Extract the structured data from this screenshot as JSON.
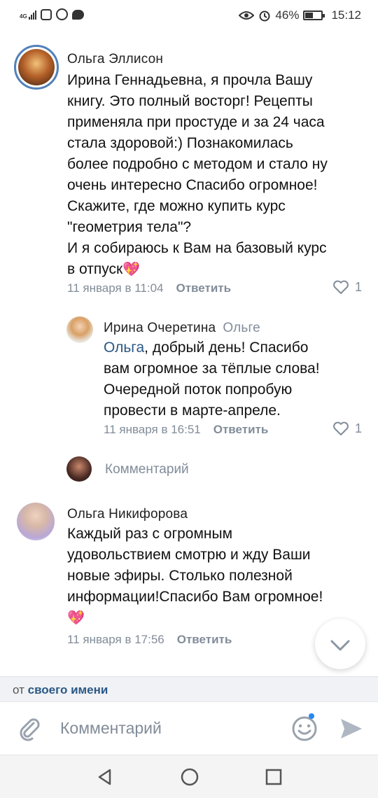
{
  "status_bar": {
    "network": "4G",
    "battery": "46%",
    "time": "15:12"
  },
  "comments": [
    {
      "author": "Ольга Эллисон",
      "text": "Ирина Геннадьевна, я прочла Вашу\nкнигу. Это полный восторг! Рецепты\nприменяла при простуде и за 24 часа\nстала здоровой:) Познакомилась\nболее подробно с методом и стало ну\nочень интересно Спасибо огромное!\nСкажите, где можно купить курс\n\"геометрия тела\"?\nИ я собираюсь к Вам на базовый курс\nв отпуск",
      "emoji": "💖",
      "date": "11 января в 11:04",
      "reply_label": "Ответить",
      "likes": "1"
    },
    {
      "author": "Ирина Очеретина",
      "reply_to": "Ольге",
      "mention": "Ольга",
      "text": ", добрый день! Спасибо\nвам огромное за тёплые слова!\nОчередной поток попробую\nпровести в марте-апреле.",
      "date": "11 января в 16:51",
      "reply_label": "Ответить",
      "likes": "1"
    },
    {
      "author": "Ольга Никифорова",
      "text": "Каждый раз с огромным\nудовольствием смотрю и жду Ваши\nновые эфиры. Столько полезной\nинформации!Спасибо Вам огромное!",
      "emoji": "💖",
      "date": "11 января в 17:56",
      "reply_label": "Ответить"
    }
  ],
  "comment_prompt": "Комментарий",
  "from_bar": {
    "prefix": "от",
    "name": "своего имени"
  },
  "composer": {
    "placeholder": "Комментарий"
  },
  "icons": {
    "attach": "paperclip-icon",
    "emoji": "smile-icon",
    "send": "send-icon",
    "like": "heart-icon",
    "scroll": "chevron-down-icon"
  },
  "colors": {
    "link": "#2a5885",
    "meta": "#818c99",
    "accent": "#5181b8",
    "heart": "#e83a8a"
  }
}
